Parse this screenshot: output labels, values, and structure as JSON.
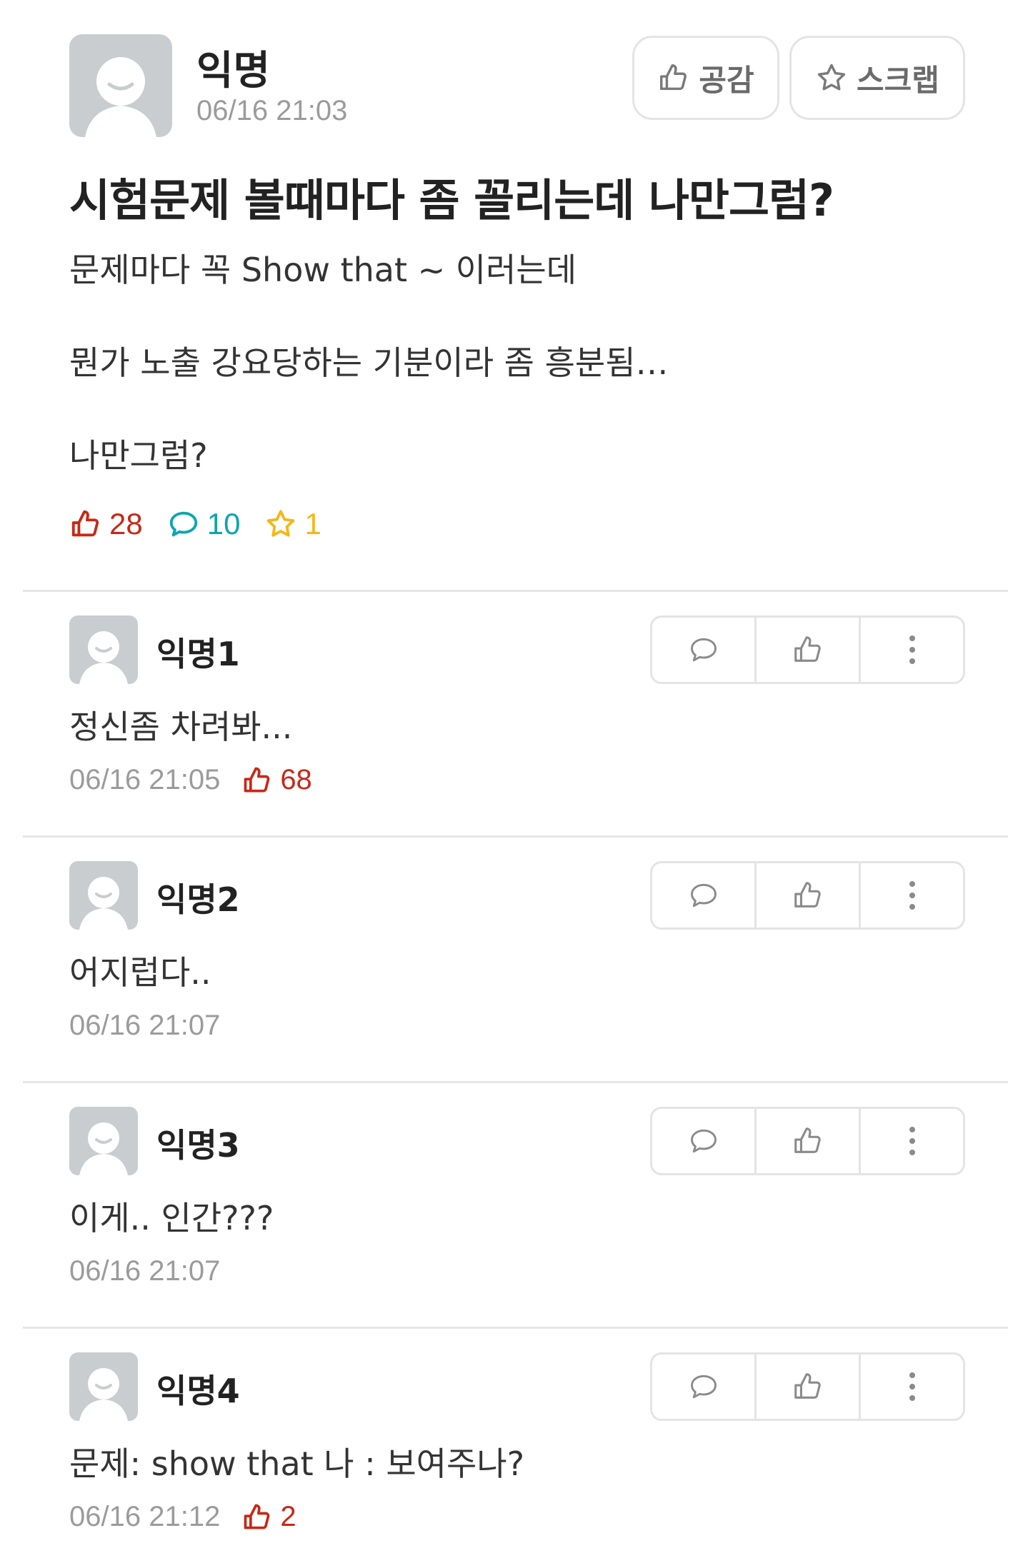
{
  "post": {
    "author": "익명",
    "time": "06/16 21:03",
    "like_button_label": "공감",
    "scrap_button_label": "스크랩",
    "title": "시험문제 볼때마다 좀 꼴리는데 나만그럼?",
    "body": [
      "문제마다 꼭 Show that ~ 이러는데",
      "뭔가 노출 강요당하는 기분이라 좀 흥분됨…",
      "나만그럼?"
    ],
    "stats": {
      "likes": "28",
      "comments": "10",
      "scraps": "1"
    }
  },
  "comments": [
    {
      "author": "익명1",
      "text": "정신좀 차려봐...",
      "time": "06/16 21:05",
      "likes": "68"
    },
    {
      "author": "익명2",
      "text": "어지럽다..",
      "time": "06/16 21:07",
      "likes": ""
    },
    {
      "author": "익명3",
      "text": "이게.. 인간???",
      "time": "06/16 21:07",
      "likes": ""
    },
    {
      "author": "익명4",
      "text": "문제: show that 나 : 보여주나?",
      "time": "06/16 21:12",
      "likes": "2"
    }
  ],
  "colors": {
    "like": "#c62917",
    "comment": "#0ca5b0",
    "scrap": "#f2b81a",
    "muted": "#9b9b9b",
    "avatar_bg": "#c9cdd0"
  }
}
